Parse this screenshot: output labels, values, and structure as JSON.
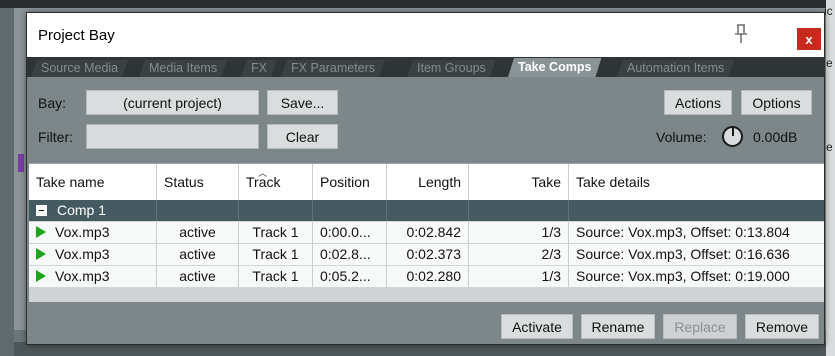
{
  "window": {
    "title": "Project Bay"
  },
  "background": {
    "right_glyphs": [
      "ic",
      "e",
      "e"
    ]
  },
  "tabs": [
    {
      "label": "Source Media",
      "active": false
    },
    {
      "label": "Media Items",
      "active": false
    },
    {
      "label": "FX",
      "active": false
    },
    {
      "label": "FX Parameters",
      "active": false
    },
    {
      "label": "Item Groups",
      "active": false
    },
    {
      "label": "Take Comps",
      "active": true
    },
    {
      "label": "Automation Items",
      "active": false
    }
  ],
  "controls": {
    "bay_label": "Bay:",
    "bay_value": "(current project)",
    "save_label": "Save...",
    "filter_label": "Filter:",
    "filter_value": "",
    "clear_label": "Clear",
    "actions_label": "Actions",
    "options_label": "Options",
    "volume_label": "Volume:",
    "volume_value": "0.00dB"
  },
  "table": {
    "columns": [
      "Take name",
      "Status",
      "Track",
      "Position",
      "Length",
      "Take",
      "Take details"
    ],
    "group": {
      "name": "Comp 1"
    },
    "rows": [
      {
        "name": "Vox.mp3",
        "status": "active",
        "track": "Track 1",
        "position": "0:00.0...",
        "length": "0:02.842",
        "take": "1/3",
        "details": "Source: Vox.mp3, Offset: 0:13.804"
      },
      {
        "name": "Vox.mp3",
        "status": "active",
        "track": "Track 1",
        "position": "0:02.8...",
        "length": "0:02.373",
        "take": "2/3",
        "details": "Source: Vox.mp3, Offset: 0:16.636"
      },
      {
        "name": "Vox.mp3",
        "status": "active",
        "track": "Track 1",
        "position": "0:05.2...",
        "length": "0:02.280",
        "take": "1/3",
        "details": "Source: Vox.mp3, Offset: 0:19.000"
      }
    ]
  },
  "footer": {
    "activate_label": "Activate",
    "rename_label": "Rename",
    "replace_label": "Replace",
    "remove_label": "Remove"
  },
  "colors": {
    "close": "#c42b1c",
    "group_row": "#435b60",
    "play": "#1aa51a",
    "tab_active": "#8a9396"
  }
}
